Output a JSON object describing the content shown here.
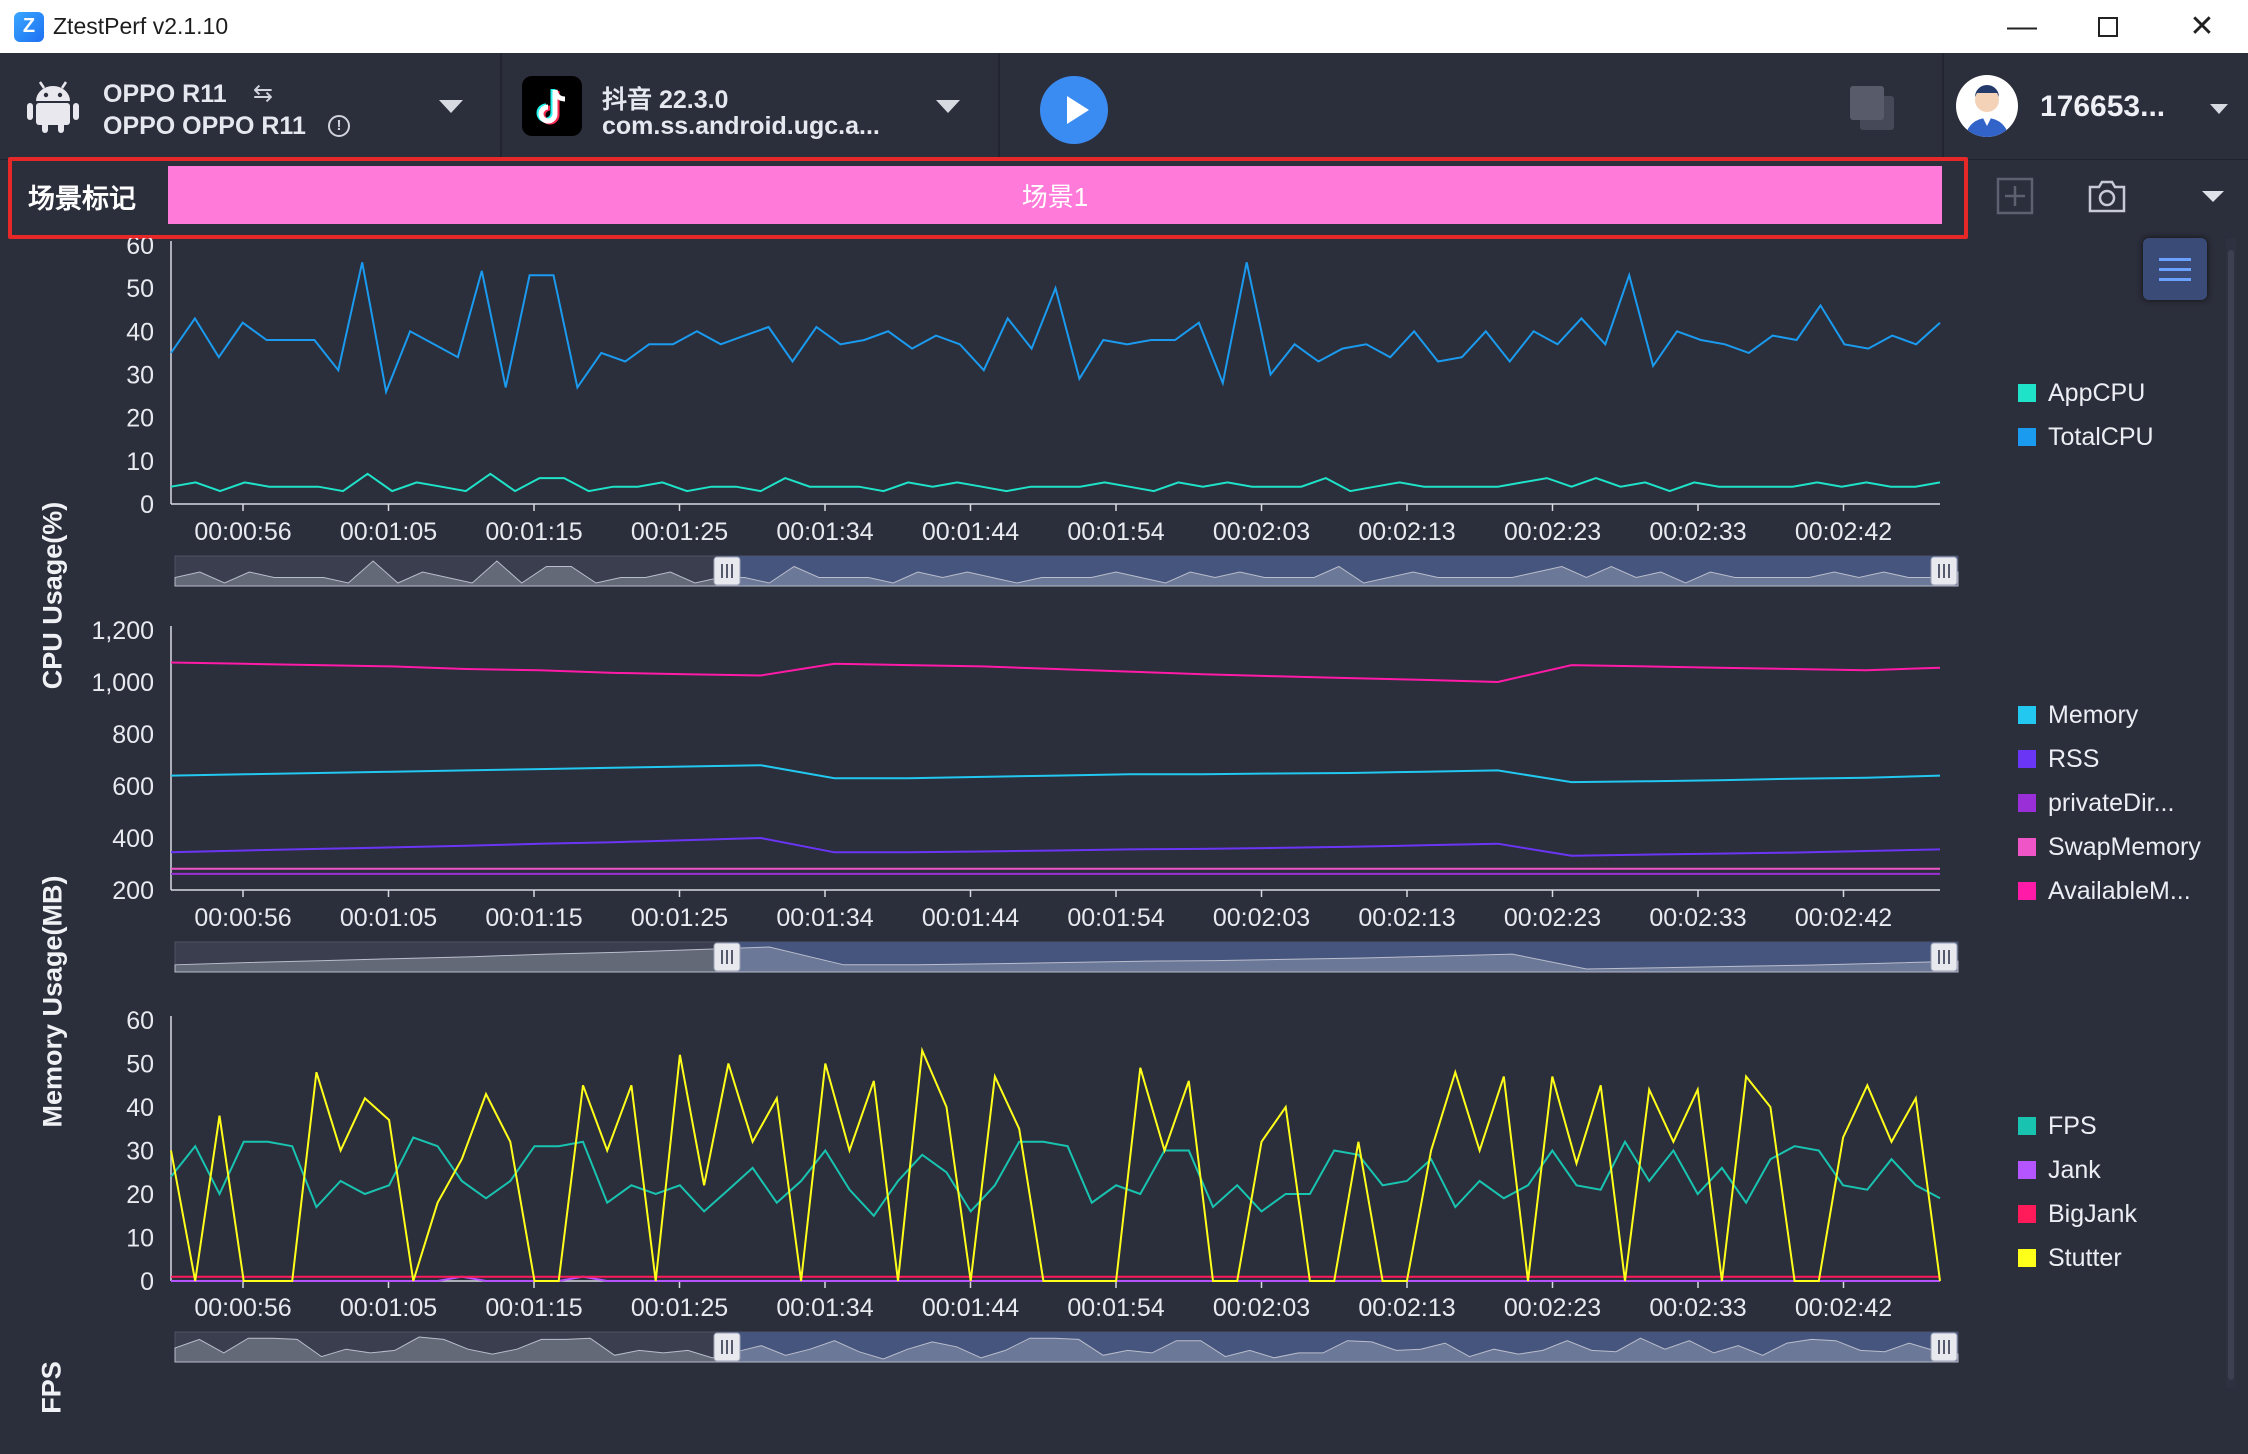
{
  "window": {
    "title": "ZtestPerf v2.1.10"
  },
  "toolbar": {
    "device_name": "OPPO R11",
    "device_model": "OPPO OPPO R11",
    "app_name": "抖音 22.3.0",
    "app_package": "com.ss.android.ugc.a...",
    "user_id": "176653..."
  },
  "scene": {
    "label": "场景标记",
    "track_label": "场景1",
    "track_color": "#ff7ad9"
  },
  "x_ticks": [
    "00:00:56",
    "00:01:05",
    "00:01:15",
    "00:01:25",
    "00:01:34",
    "00:01:44",
    "00:01:54",
    "00:02:03",
    "00:02:13",
    "00:02:23",
    "00:02:33",
    "00:02:42"
  ],
  "chart_data": [
    {
      "type": "line",
      "ylabel": "CPU Usage(%)",
      "ylim": [
        0,
        60
      ],
      "yticks": [
        "0",
        "10",
        "20",
        "30",
        "40",
        "50",
        "60"
      ],
      "series": [
        {
          "name": "AppCPU",
          "color": "#1ee3c8",
          "values": [
            4,
            5,
            3,
            5,
            4,
            4,
            4,
            3,
            7,
            3,
            5,
            4,
            3,
            7,
            3,
            6,
            6,
            3,
            4,
            4,
            5,
            3,
            4,
            4,
            3,
            6,
            4,
            4,
            4,
            3,
            5,
            4,
            5,
            4,
            3,
            4,
            4,
            4,
            5,
            4,
            3,
            5,
            4,
            5,
            4,
            4,
            4,
            6,
            3,
            4,
            5,
            4,
            4,
            4,
            4,
            5,
            6,
            4,
            6,
            4,
            5,
            3,
            5,
            4,
            4,
            4,
            4,
            5,
            4,
            5,
            4,
            4,
            5
          ]
        },
        {
          "name": "TotalCPU",
          "color": "#1a9bf0",
          "values": [
            35,
            43,
            34,
            42,
            38,
            38,
            38,
            31,
            56,
            26,
            40,
            37,
            34,
            54,
            27,
            53,
            53,
            27,
            35,
            33,
            37,
            37,
            40,
            37,
            39,
            41,
            33,
            41,
            37,
            38,
            40,
            36,
            39,
            37,
            31,
            43,
            36,
            50,
            29,
            38,
            37,
            38,
            38,
            42,
            28,
            56,
            30,
            37,
            33,
            36,
            37,
            34,
            40,
            33,
            34,
            40,
            33,
            40,
            37,
            43,
            37,
            53,
            32,
            40,
            38,
            37,
            35,
            39,
            38,
            46,
            37,
            36,
            39,
            37,
            42
          ]
        }
      ]
    },
    {
      "type": "line",
      "ylabel": "Memory Usage(MB)",
      "ylim": [
        200,
        1200
      ],
      "yticks": [
        "200",
        "400",
        "600",
        "800",
        "1,000",
        "1,200"
      ],
      "series": [
        {
          "name": "Memory",
          "color": "#22c8f0",
          "values": [
            640,
            645,
            650,
            655,
            660,
            665,
            670,
            675,
            680,
            630,
            630,
            635,
            640,
            645,
            645,
            648,
            650,
            655,
            660,
            615,
            618,
            622,
            628,
            632,
            640
          ]
        },
        {
          "name": "RSS",
          "color": "#6a35f5",
          "values": [
            345,
            352,
            358,
            364,
            370,
            378,
            384,
            392,
            400,
            345,
            345,
            348,
            352,
            356,
            358,
            362,
            366,
            372,
            378,
            332,
            336,
            340,
            344,
            350,
            356
          ]
        },
        {
          "name": "privateDir...",
          "color": "#9a2fd8",
          "values": [
            262,
            262,
            262,
            262,
            262,
            262,
            262,
            262,
            262,
            262,
            262,
            262,
            262,
            262,
            262,
            262,
            262,
            262,
            262,
            262,
            262,
            262,
            262,
            262,
            262
          ]
        },
        {
          "name": "SwapMemory",
          "color": "#f055c8",
          "values": [
            282,
            282,
            282,
            282,
            282,
            282,
            282,
            282,
            282,
            282,
            282,
            282,
            282,
            282,
            282,
            282,
            282,
            282,
            282,
            282,
            282,
            282,
            282,
            282,
            282
          ]
        },
        {
          "name": "AvailableM...",
          "color": "#ff1aa8",
          "values": [
            1075,
            1070,
            1065,
            1060,
            1050,
            1045,
            1035,
            1030,
            1025,
            1070,
            1065,
            1060,
            1050,
            1040,
            1030,
            1022,
            1015,
            1008,
            1000,
            1065,
            1060,
            1055,
            1050,
            1045,
            1055
          ]
        }
      ]
    },
    {
      "type": "line",
      "ylabel": "FPS",
      "ylim": [
        0,
        60
      ],
      "yticks": [
        "0",
        "10",
        "20",
        "30",
        "40",
        "50",
        "60"
      ],
      "series": [
        {
          "name": "FPS",
          "color": "#18c4b0",
          "values": [
            24,
            31,
            20,
            32,
            32,
            31,
            17,
            23,
            20,
            22,
            33,
            31,
            23,
            19,
            23,
            31,
            31,
            32,
            18,
            22,
            20,
            22,
            16,
            21,
            26,
            18,
            23,
            30,
            21,
            15,
            23,
            29,
            25,
            16,
            22,
            32,
            32,
            31,
            18,
            22,
            20,
            30,
            30,
            17,
            22,
            16,
            20,
            20,
            30,
            29,
            22,
            23,
            28,
            17,
            23,
            19,
            22,
            30,
            22,
            21,
            32,
            23,
            30,
            20,
            26,
            18,
            28,
            31,
            30,
            22,
            21,
            28,
            22,
            19
          ]
        },
        {
          "name": "Jank",
          "color": "#b455ff",
          "values": [
            0,
            0,
            0,
            0,
            0,
            0,
            0,
            0,
            0,
            0,
            0,
            0,
            1,
            0,
            0,
            0,
            0,
            1,
            0,
            0,
            0,
            0,
            0,
            0,
            0,
            0,
            0,
            0,
            0,
            0,
            0,
            0,
            0,
            0,
            0,
            0,
            0,
            0,
            0,
            0,
            0,
            0,
            0,
            0,
            0,
            0,
            0,
            0,
            0,
            0,
            0,
            0,
            0,
            0,
            0,
            0,
            0,
            0,
            0,
            0,
            0,
            0,
            0,
            0,
            0,
            0,
            0,
            0,
            0,
            0,
            0,
            0,
            0,
            0
          ]
        },
        {
          "name": "BigJank",
          "color": "#ff1a5a",
          "values": [
            1,
            1,
            1,
            1,
            1,
            1,
            1,
            1,
            1,
            1,
            1,
            1,
            1,
            1,
            1,
            1,
            1,
            1,
            1,
            1,
            1,
            1,
            1,
            1,
            1,
            1,
            1,
            1,
            1,
            1,
            1,
            1,
            1,
            1,
            1,
            1,
            1,
            1,
            1,
            1,
            1,
            1,
            1,
            1,
            1,
            1,
            1,
            1,
            1,
            1,
            1,
            1,
            1,
            1,
            1,
            1,
            1,
            1,
            1,
            1,
            1,
            1,
            1,
            1,
            1,
            1,
            1,
            1,
            1,
            1,
            1,
            1,
            1,
            1
          ]
        },
        {
          "name": "Stutter",
          "color": "#ffff1a",
          "values": [
            30,
            0,
            38,
            0,
            0,
            0,
            48,
            30,
            42,
            37,
            0,
            18,
            28,
            43,
            32,
            0,
            0,
            45,
            30,
            45,
            0,
            52,
            22,
            50,
            32,
            42,
            0,
            50,
            30,
            46,
            0,
            53,
            40,
            0,
            47,
            35,
            0,
            0,
            0,
            0,
            49,
            30,
            46,
            0,
            0,
            32,
            40,
            0,
            0,
            32,
            0,
            0,
            30,
            48,
            30,
            47,
            0,
            47,
            27,
            45,
            0,
            44,
            32,
            44,
            0,
            47,
            40,
            0,
            0,
            33,
            45,
            32,
            42,
            0
          ]
        }
      ]
    }
  ]
}
